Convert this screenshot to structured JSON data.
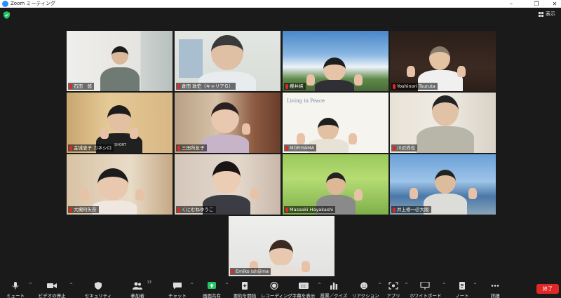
{
  "window": {
    "title": "Zoom ミーティング",
    "min": "–",
    "max": "❐",
    "close": "✕"
  },
  "topbar": {
    "view_label": "表示",
    "security_color": "#22c55e"
  },
  "participants": [
    {
      "name": "石田　悠"
    },
    {
      "name": "倉田 敦史（キャリアＧ）"
    },
    {
      "name": "櫻井純"
    },
    {
      "name": "Yoshinori Tsuruta"
    },
    {
      "name": "金城恵子  カネシロ"
    },
    {
      "name": "三田所友子"
    },
    {
      "name": "MORIYAMA"
    },
    {
      "name": "川辺尚也"
    },
    {
      "name": "大槻阿矢奈"
    },
    {
      "name": "くにむねゆうこ"
    },
    {
      "name": "Masaaki Hayakashi"
    },
    {
      "name": "井上修一＠大阪"
    },
    {
      "name": "Emiko Ishijima"
    }
  ],
  "tile_texts": {
    "watermark": "Living in Peace",
    "shirt_text": "SHORT"
  },
  "toolbar": {
    "mute": "ミュート",
    "video": "ビデオの停止",
    "security": "セキュリティ",
    "participants": "参加者",
    "participants_count": "13",
    "chat": "チャット",
    "share": "画面共有",
    "summary": "要約を開始",
    "record": "レコーディング",
    "captions": "字幕を表示",
    "polls": "投票／クイズ",
    "reactions": "リアクション",
    "apps": "アプリ",
    "whiteboard": "ホワイトボード",
    "notes": "ノート",
    "more": "詳細",
    "end": "終了",
    "share_color": "#22c55e",
    "end_color": "#e02828"
  }
}
